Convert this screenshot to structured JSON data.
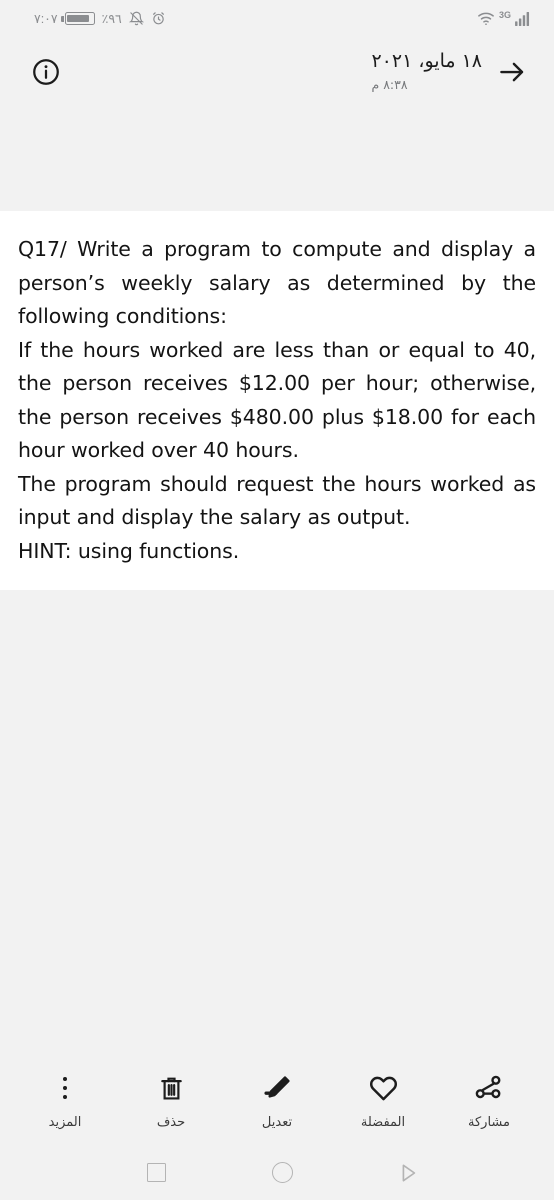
{
  "status_bar": {
    "clock": "٧:٠٧",
    "battery_percent": "٪٩٦",
    "network_type": "3G",
    "icons": [
      "battery-icon",
      "mute-bell-icon",
      "alarm-clock-icon",
      "wifi-icon",
      "signal-bars-icon"
    ]
  },
  "header": {
    "date": "١٨ مايو، ٢٠٢١",
    "time": "٨:٣٨ م",
    "back_icon": "arrow-right-icon",
    "info_icon": "info-circle-icon"
  },
  "document": {
    "lines": [
      "Q17/ Write a program to compute and display a person’s weekly salary as determined by the following conditions:",
      "If the hours worked are less than or equal to 40, the person receives $12.00 per hour; otherwise, the person receives $480.00 plus $18.00 for each hour worked over 40 hours.",
      "The program should request the hours worked as input and display the salary as output.",
      "HINT: using functions."
    ],
    "paragraph_1": "Q17/ Write a program to compute and display a person’s weekly salary as determined by the following conditions:",
    "paragraph_2": "If the hours worked are less than or equal to 40, the person receives $12.00 per hour; otherwise, the person receives $480.00 plus $18.00 for each hour worked over 40 hours.",
    "paragraph_3": "The program should request the hours worked as input and display the salary as output.",
    "paragraph_4": "HINT: using functions."
  },
  "action_bar": {
    "items": [
      {
        "label": "مشاركة",
        "icon": "share-icon"
      },
      {
        "label": "المفضلة",
        "icon": "heart-icon"
      },
      {
        "label": "تعديل",
        "icon": "pencil-edit-icon"
      },
      {
        "label": "حذف",
        "icon": "trash-icon"
      },
      {
        "label": "المزيد",
        "icon": "more-vertical-icon"
      }
    ]
  },
  "nav_bar": {
    "recents_icon": "square-icon",
    "home_icon": "circle-icon",
    "back_icon": "triangle-right-icon"
  },
  "colors": {
    "background": "#f2f2f2",
    "card": "#ffffff",
    "text": "#141414",
    "muted": "#8b8d90",
    "nav": "#b4b4b4"
  }
}
